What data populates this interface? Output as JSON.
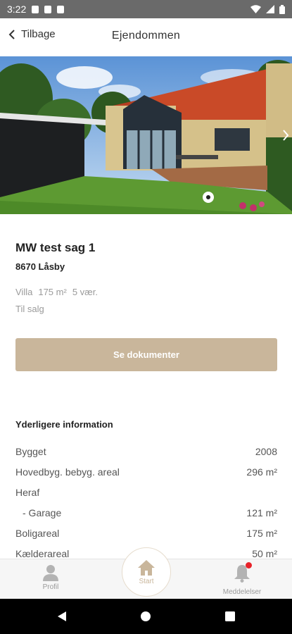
{
  "status_bar": {
    "time": "3:22"
  },
  "header": {
    "back_label": "Tilbage",
    "title": "Ejendommen"
  },
  "property": {
    "name": "MW test sag 1",
    "city": "8670 Låsby",
    "type": "Villa",
    "area": "175 m²",
    "rooms": "5 vær.",
    "status": "Til salg"
  },
  "buttons": {
    "documents": "Se dokumenter"
  },
  "info": {
    "title": "Yderligere information",
    "rows": [
      {
        "label": "Bygget",
        "value": "2008"
      },
      {
        "label": "Hovedbyg. bebyg. areal",
        "value": "296 m²"
      },
      {
        "label": "Heraf",
        "value": ""
      },
      {
        "label": "- Garage",
        "value": "121 m²"
      },
      {
        "label": "Boligareal",
        "value": "175 m²"
      },
      {
        "label": "Kælderareal",
        "value": "50 m²"
      }
    ]
  },
  "nav": {
    "profile": "Profil",
    "start": "Start",
    "messages": "Meddelelser"
  },
  "colors": {
    "accent": "#c9b69b",
    "badge": "#e8232a"
  }
}
